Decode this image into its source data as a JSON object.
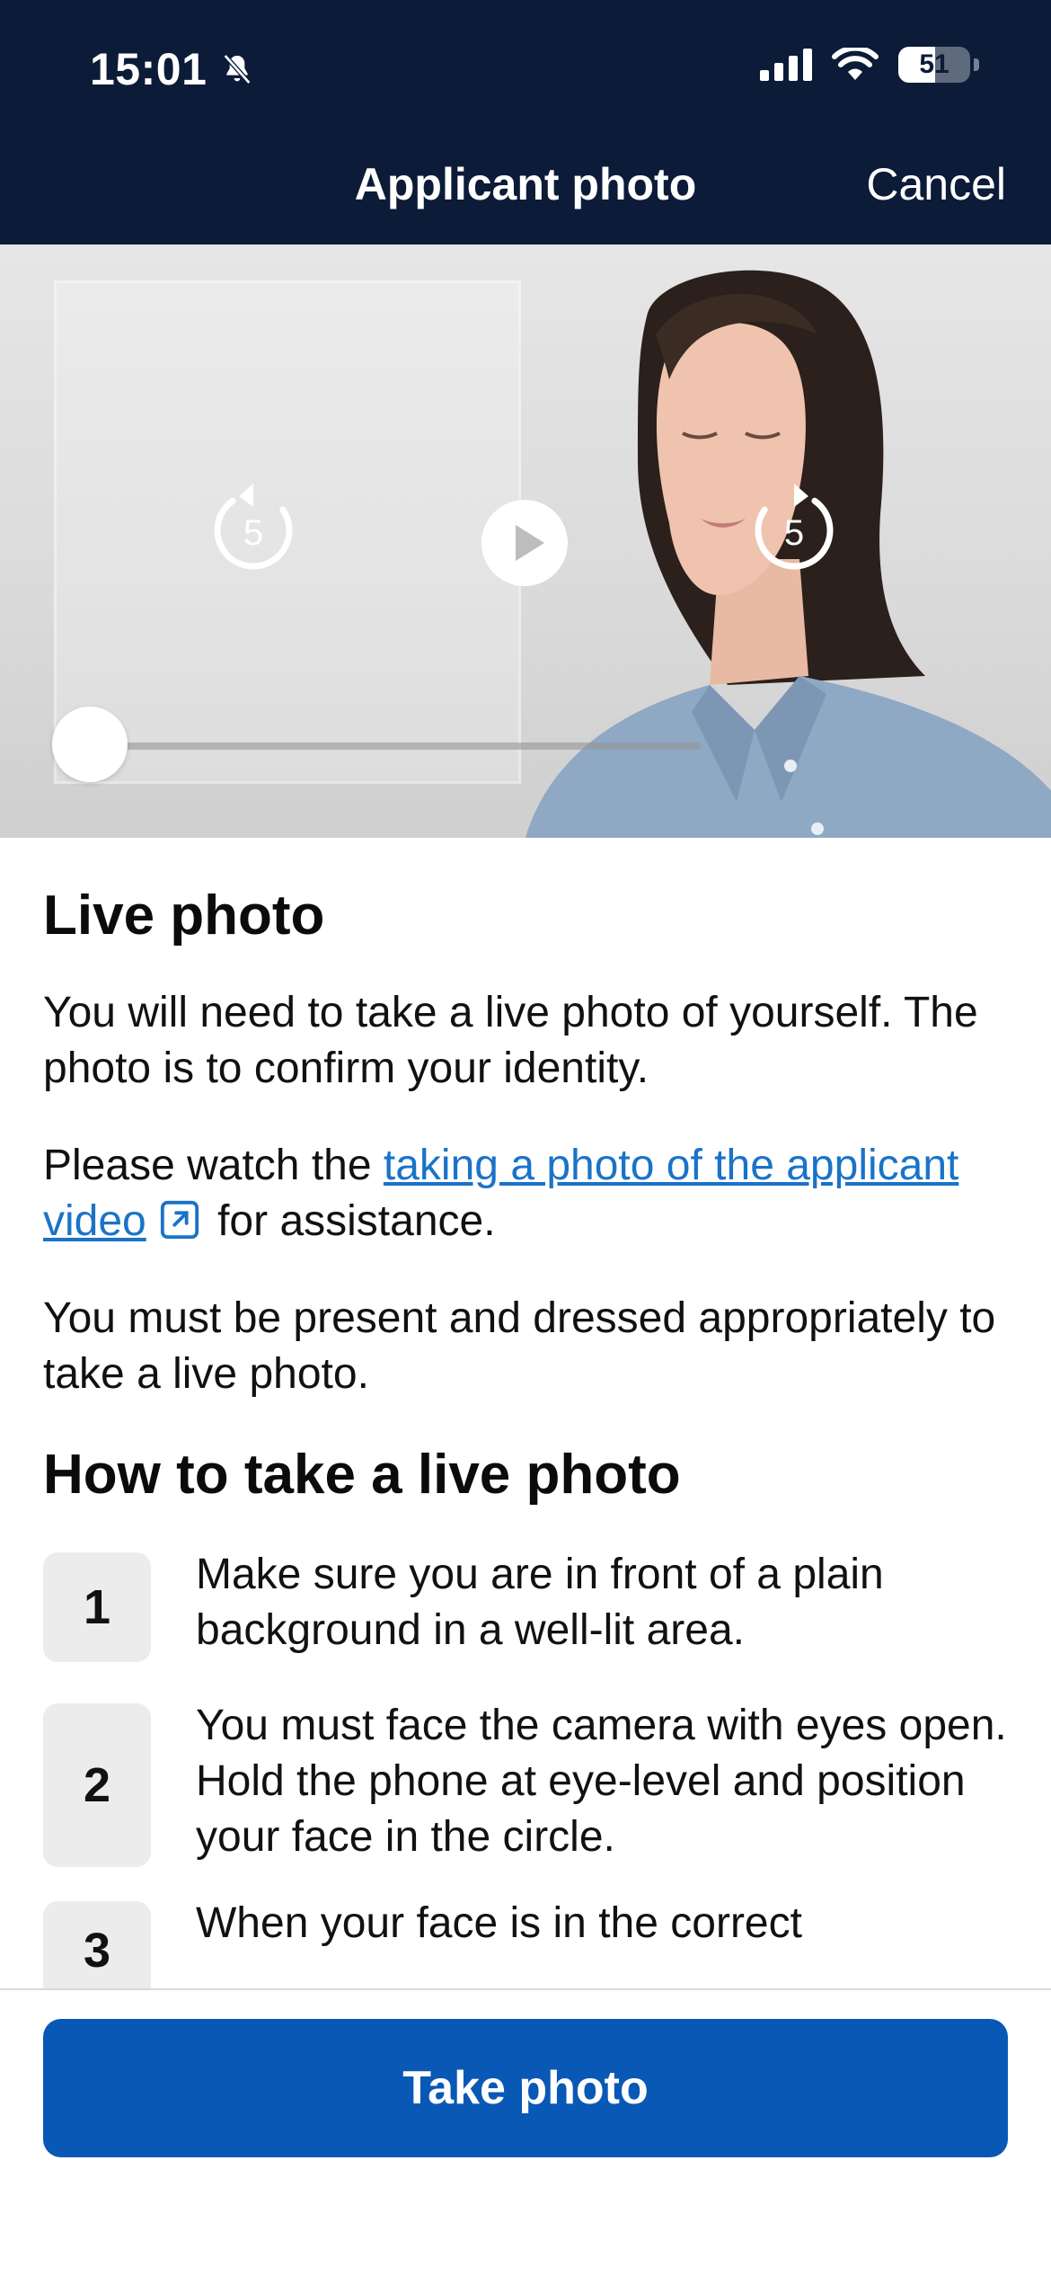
{
  "status_bar": {
    "time": "15:01",
    "battery": "51",
    "battery_level_percent": 51,
    "icons": [
      "bell-slash-icon",
      "signal-icon",
      "wifi-icon",
      "battery-icon"
    ]
  },
  "nav": {
    "title": "Applicant photo",
    "cancel_label": "Cancel"
  },
  "video": {
    "rewind_seconds": "5",
    "forward_seconds": "5",
    "icons": [
      "rewind-5-icon",
      "play-icon",
      "forward-5-icon"
    ],
    "progress": 0
  },
  "live_photo": {
    "heading": "Live photo",
    "para1": "You will need to take a live photo of yourself. The photo is to confirm your identity.",
    "para2_prefix": "Please watch the ",
    "para2_link": "taking a photo of the applicant video",
    "para2_suffix": " for assistance.",
    "para3": "You must be present and dressed appropriately to take a live photo."
  },
  "how_to": {
    "heading": "How to take a live photo",
    "steps": [
      {
        "number": "1",
        "text": "Make sure you are in front of a plain background in a well-lit area."
      },
      {
        "number": "2",
        "text": "You must face the camera with eyes open. Hold the phone at eye-level and position your face in the circle."
      },
      {
        "number": "3",
        "text": "When your face is in the correct"
      }
    ]
  },
  "footer": {
    "take_photo_label": "Take photo"
  },
  "colors": {
    "header_bg": "#0c1b38",
    "primary_button": "#0a58b5",
    "link": "#1a73c8"
  }
}
